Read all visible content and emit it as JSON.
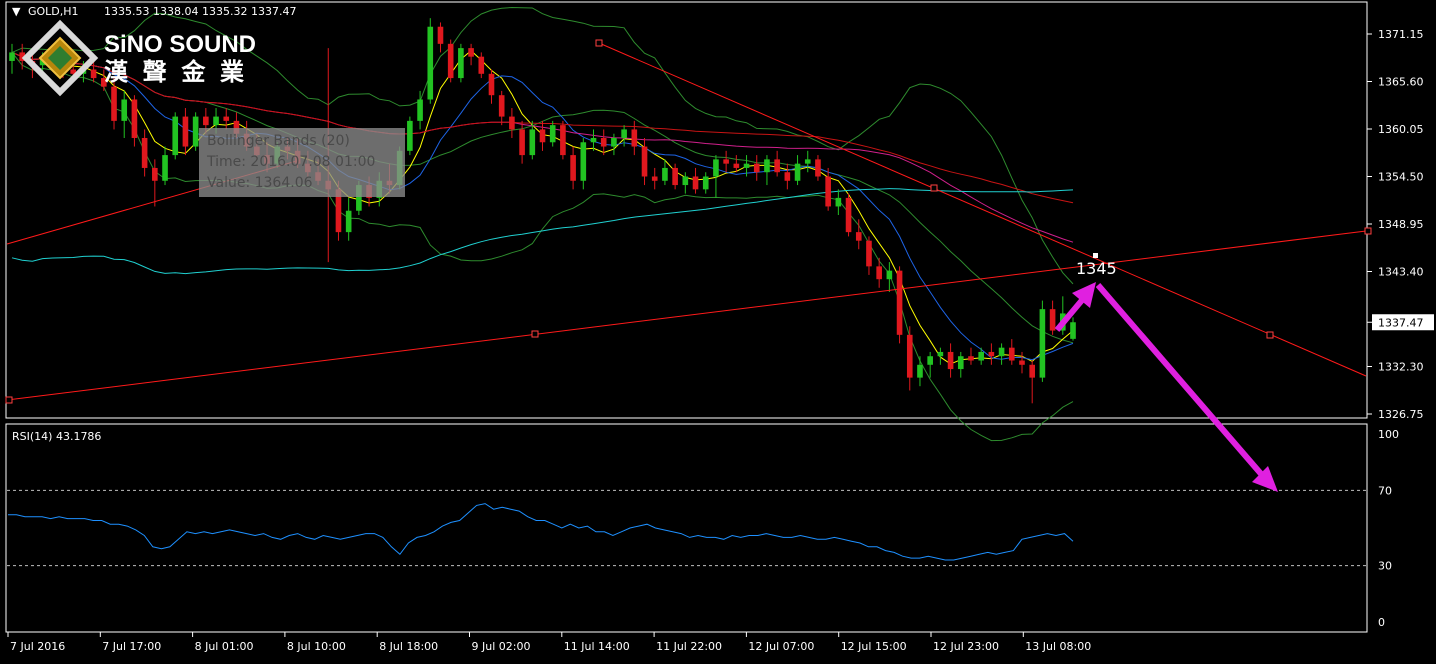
{
  "header": {
    "symbol": "GOLD,H1",
    "ohlc": "1335.53 1338.04 1335.32 1337.47"
  },
  "logo": {
    "name": "SiNO SOUND",
    "chinese": "漢 聲 金 業"
  },
  "tooltip": {
    "line1": "Bollinger Bands (20)",
    "line2": "Time: 2016.07.08 01:00",
    "line3": "Value: 1364.06"
  },
  "annotation": {
    "label": "1345"
  },
  "price_axis": {
    "ticks": [
      "1371.15",
      "1365.60",
      "1360.05",
      "1354.50",
      "1348.95",
      "1343.40",
      "1337.47",
      "1332.30",
      "1326.75"
    ],
    "current_price": "1337.47"
  },
  "rsi": {
    "label": "RSI(14) 43.1786",
    "ticks": [
      "100",
      "70",
      "30",
      "0"
    ]
  },
  "time_axis": {
    "labels": [
      "7 Jul 2016",
      "7 Jul 17:00",
      "8 Jul 01:00",
      "8 Jul 10:00",
      "8 Jul 18:00",
      "9 Jul 02:00",
      "11 Jul 14:00",
      "11 Jul 22:00",
      "12 Jul 07:00",
      "12 Jul 15:00",
      "12 Jul 23:00",
      "13 Jul 08:00"
    ]
  },
  "colors": {
    "background": "#000000",
    "bull": "#22c322",
    "bear": "#e0181e",
    "bollinger": "#2e8b2e",
    "ma_yellow": "#ffff00",
    "ma_blue": "#1e64e6",
    "ma_magenta": "#d0208c",
    "ma_red": "#c81414",
    "ma_cyan": "#20d0d0",
    "trendline": "#ff1a1a",
    "rsi_line": "#1e90ff",
    "arrow": "#e020e0",
    "axis": "#ffffff"
  },
  "chart_data": {
    "type": "candlestick",
    "title": "GOLD,H1",
    "ylim": [
      1325,
      1373
    ],
    "candles": [
      {
        "o": 1368.0,
        "h": 1370.0,
        "l": 1366.5,
        "c": 1369.0
      },
      {
        "o": 1369.0,
        "h": 1370.0,
        "l": 1367.0,
        "c": 1368.0
      },
      {
        "o": 1368.0,
        "h": 1369.5,
        "l": 1366.0,
        "c": 1367.5
      },
      {
        "o": 1367.5,
        "h": 1369.0,
        "l": 1366.5,
        "c": 1368.5
      },
      {
        "o": 1368.5,
        "h": 1369.5,
        "l": 1367.0,
        "c": 1367.5
      },
      {
        "o": 1367.5,
        "h": 1368.5,
        "l": 1366.0,
        "c": 1367.0
      },
      {
        "o": 1367.0,
        "h": 1368.0,
        "l": 1365.5,
        "c": 1366.5
      },
      {
        "o": 1366.5,
        "h": 1368.0,
        "l": 1365.5,
        "c": 1367.0
      },
      {
        "o": 1367.0,
        "h": 1368.0,
        "l": 1365.5,
        "c": 1366.0
      },
      {
        "o": 1366.0,
        "h": 1367.0,
        "l": 1364.5,
        "c": 1365.0
      },
      {
        "o": 1365.0,
        "h": 1366.0,
        "l": 1360.0,
        "c": 1361.0
      },
      {
        "o": 1361.0,
        "h": 1364.5,
        "l": 1359.0,
        "c": 1363.5
      },
      {
        "o": 1363.5,
        "h": 1364.0,
        "l": 1358.0,
        "c": 1359.0
      },
      {
        "o": 1359.0,
        "h": 1360.0,
        "l": 1354.5,
        "c": 1355.5
      },
      {
        "o": 1355.5,
        "h": 1356.5,
        "l": 1351.0,
        "c": 1354.0
      },
      {
        "o": 1354.0,
        "h": 1358.0,
        "l": 1353.5,
        "c": 1357.0
      },
      {
        "o": 1357.0,
        "h": 1362.0,
        "l": 1356.5,
        "c": 1361.5
      },
      {
        "o": 1361.5,
        "h": 1362.5,
        "l": 1357.0,
        "c": 1358.0
      },
      {
        "o": 1358.0,
        "h": 1362.0,
        "l": 1357.5,
        "c": 1361.5
      },
      {
        "o": 1361.5,
        "h": 1362.5,
        "l": 1359.5,
        "c": 1360.5
      },
      {
        "o": 1360.5,
        "h": 1362.5,
        "l": 1359.5,
        "c": 1361.5
      },
      {
        "o": 1361.5,
        "h": 1362.5,
        "l": 1360.0,
        "c": 1361.0
      },
      {
        "o": 1361.0,
        "h": 1362.0,
        "l": 1359.0,
        "c": 1359.5
      },
      {
        "o": 1359.5,
        "h": 1361.0,
        "l": 1357.5,
        "c": 1358.0
      },
      {
        "o": 1358.0,
        "h": 1359.5,
        "l": 1356.5,
        "c": 1357.0
      },
      {
        "o": 1357.0,
        "h": 1358.5,
        "l": 1355.0,
        "c": 1356.0
      },
      {
        "o": 1356.0,
        "h": 1358.5,
        "l": 1355.5,
        "c": 1358.0
      },
      {
        "o": 1358.0,
        "h": 1359.0,
        "l": 1356.5,
        "c": 1357.5
      },
      {
        "o": 1357.5,
        "h": 1359.0,
        "l": 1355.5,
        "c": 1356.0
      },
      {
        "o": 1356.0,
        "h": 1357.5,
        "l": 1354.5,
        "c": 1355.0
      },
      {
        "o": 1355.0,
        "h": 1356.5,
        "l": 1353.5,
        "c": 1354.0
      },
      {
        "o": 1354.0,
        "h": 1369.5,
        "l": 1344.5,
        "c": 1353.0
      },
      {
        "o": 1353.0,
        "h": 1354.0,
        "l": 1347.0,
        "c": 1348.0
      },
      {
        "o": 1348.0,
        "h": 1352.0,
        "l": 1347.0,
        "c": 1350.5
      },
      {
        "o": 1350.5,
        "h": 1354.0,
        "l": 1350.0,
        "c": 1353.5
      },
      {
        "o": 1353.5,
        "h": 1354.5,
        "l": 1351.0,
        "c": 1352.0
      },
      {
        "o": 1352.0,
        "h": 1355.0,
        "l": 1351.0,
        "c": 1354.0
      },
      {
        "o": 1354.0,
        "h": 1356.0,
        "l": 1352.5,
        "c": 1353.5
      },
      {
        "o": 1353.5,
        "h": 1358.0,
        "l": 1353.0,
        "c": 1357.5
      },
      {
        "o": 1357.5,
        "h": 1361.5,
        "l": 1357.0,
        "c": 1361.0
      },
      {
        "o": 1361.0,
        "h": 1364.5,
        "l": 1360.0,
        "c": 1363.5
      },
      {
        "o": 1363.5,
        "h": 1373.0,
        "l": 1363.0,
        "c": 1372.0
      },
      {
        "o": 1372.0,
        "h": 1372.5,
        "l": 1369.0,
        "c": 1370.0
      },
      {
        "o": 1370.0,
        "h": 1370.5,
        "l": 1365.5,
        "c": 1366.0
      },
      {
        "o": 1366.0,
        "h": 1370.0,
        "l": 1365.5,
        "c": 1369.5
      },
      {
        "o": 1369.5,
        "h": 1370.0,
        "l": 1367.5,
        "c": 1368.5
      },
      {
        "o": 1368.5,
        "h": 1369.0,
        "l": 1366.0,
        "c": 1366.5
      },
      {
        "o": 1366.5,
        "h": 1367.0,
        "l": 1363.0,
        "c": 1364.0
      },
      {
        "o": 1364.0,
        "h": 1364.5,
        "l": 1360.5,
        "c": 1361.5
      },
      {
        "o": 1361.5,
        "h": 1362.5,
        "l": 1359.0,
        "c": 1360.0
      },
      {
        "o": 1360.0,
        "h": 1361.0,
        "l": 1356.0,
        "c": 1357.0
      },
      {
        "o": 1357.0,
        "h": 1361.0,
        "l": 1356.5,
        "c": 1360.0
      },
      {
        "o": 1360.0,
        "h": 1361.0,
        "l": 1357.5,
        "c": 1358.5
      },
      {
        "o": 1358.5,
        "h": 1361.0,
        "l": 1358.0,
        "c": 1360.5
      },
      {
        "o": 1360.5,
        "h": 1361.0,
        "l": 1356.5,
        "c": 1357.0
      },
      {
        "o": 1357.0,
        "h": 1358.0,
        "l": 1353.0,
        "c": 1354.0
      },
      {
        "o": 1354.0,
        "h": 1359.0,
        "l": 1353.0,
        "c": 1358.5
      },
      {
        "o": 1358.5,
        "h": 1360.0,
        "l": 1357.5,
        "c": 1359.0
      },
      {
        "o": 1359.0,
        "h": 1360.0,
        "l": 1357.0,
        "c": 1358.0
      },
      {
        "o": 1358.0,
        "h": 1359.5,
        "l": 1357.0,
        "c": 1359.0
      },
      {
        "o": 1359.0,
        "h": 1360.5,
        "l": 1358.0,
        "c": 1360.0
      },
      {
        "o": 1360.0,
        "h": 1361.0,
        "l": 1357.0,
        "c": 1358.0
      },
      {
        "o": 1358.0,
        "h": 1359.0,
        "l": 1353.5,
        "c": 1354.5
      },
      {
        "o": 1354.5,
        "h": 1355.5,
        "l": 1353.0,
        "c": 1354.0
      },
      {
        "o": 1354.0,
        "h": 1356.5,
        "l": 1353.5,
        "c": 1355.5
      },
      {
        "o": 1355.5,
        "h": 1356.0,
        "l": 1353.0,
        "c": 1353.5
      },
      {
        "o": 1353.5,
        "h": 1355.0,
        "l": 1352.5,
        "c": 1354.5
      },
      {
        "o": 1354.5,
        "h": 1355.5,
        "l": 1352.5,
        "c": 1353.0
      },
      {
        "o": 1353.0,
        "h": 1355.0,
        "l": 1352.5,
        "c": 1354.5
      },
      {
        "o": 1354.5,
        "h": 1357.0,
        "l": 1352.0,
        "c": 1356.5
      },
      {
        "o": 1356.5,
        "h": 1357.5,
        "l": 1355.0,
        "c": 1356.0
      },
      {
        "o": 1356.0,
        "h": 1357.0,
        "l": 1355.0,
        "c": 1355.5
      },
      {
        "o": 1355.5,
        "h": 1357.0,
        "l": 1354.5,
        "c": 1356.0
      },
      {
        "o": 1356.0,
        "h": 1357.0,
        "l": 1354.0,
        "c": 1355.0
      },
      {
        "o": 1355.0,
        "h": 1357.0,
        "l": 1353.5,
        "c": 1356.5
      },
      {
        "o": 1356.5,
        "h": 1357.5,
        "l": 1354.5,
        "c": 1355.0
      },
      {
        "o": 1355.0,
        "h": 1356.0,
        "l": 1353.0,
        "c": 1354.0
      },
      {
        "o": 1354.0,
        "h": 1357.0,
        "l": 1353.5,
        "c": 1356.0
      },
      {
        "o": 1356.0,
        "h": 1357.5,
        "l": 1355.0,
        "c": 1356.5
      },
      {
        "o": 1356.5,
        "h": 1357.0,
        "l": 1354.0,
        "c": 1354.5
      },
      {
        "o": 1354.5,
        "h": 1355.5,
        "l": 1350.5,
        "c": 1351.0
      },
      {
        "o": 1351.0,
        "h": 1353.0,
        "l": 1350.0,
        "c": 1352.0
      },
      {
        "o": 1352.0,
        "h": 1352.5,
        "l": 1347.5,
        "c": 1348.0
      },
      {
        "o": 1348.0,
        "h": 1349.5,
        "l": 1346.0,
        "c": 1347.0
      },
      {
        "o": 1347.0,
        "h": 1347.5,
        "l": 1343.0,
        "c": 1344.0
      },
      {
        "o": 1344.0,
        "h": 1345.0,
        "l": 1341.5,
        "c": 1342.5
      },
      {
        "o": 1342.5,
        "h": 1344.5,
        "l": 1341.0,
        "c": 1343.5
      },
      {
        "o": 1343.5,
        "h": 1344.0,
        "l": 1335.0,
        "c": 1336.0
      },
      {
        "o": 1336.0,
        "h": 1337.0,
        "l": 1329.5,
        "c": 1331.0
      },
      {
        "o": 1331.0,
        "h": 1333.5,
        "l": 1330.0,
        "c": 1332.5
      },
      {
        "o": 1332.5,
        "h": 1334.0,
        "l": 1331.0,
        "c": 1333.5
      },
      {
        "o": 1333.5,
        "h": 1334.5,
        "l": 1332.5,
        "c": 1334.0
      },
      {
        "o": 1334.0,
        "h": 1335.0,
        "l": 1331.0,
        "c": 1332.0
      },
      {
        "o": 1332.0,
        "h": 1334.0,
        "l": 1331.0,
        "c": 1333.5
      },
      {
        "o": 1333.5,
        "h": 1334.5,
        "l": 1332.5,
        "c": 1333.0
      },
      {
        "o": 1333.0,
        "h": 1334.5,
        "l": 1332.5,
        "c": 1334.0
      },
      {
        "o": 1334.0,
        "h": 1335.0,
        "l": 1332.5,
        "c": 1333.5
      },
      {
        "o": 1333.5,
        "h": 1335.0,
        "l": 1332.5,
        "c": 1334.5
      },
      {
        "o": 1334.5,
        "h": 1335.5,
        "l": 1332.5,
        "c": 1333.0
      },
      {
        "o": 1333.0,
        "h": 1334.0,
        "l": 1331.5,
        "c": 1332.5
      },
      {
        "o": 1332.5,
        "h": 1333.0,
        "l": 1328.0,
        "c": 1331.0
      },
      {
        "o": 1331.0,
        "h": 1340.0,
        "l": 1330.5,
        "c": 1339.0
      },
      {
        "o": 1339.0,
        "h": 1340.0,
        "l": 1336.0,
        "c": 1336.5
      },
      {
        "o": 1336.5,
        "h": 1340.5,
        "l": 1336.0,
        "c": 1338.5
      },
      {
        "o": 1335.53,
        "h": 1338.04,
        "l": 1335.32,
        "c": 1337.47
      }
    ],
    "rsi": [
      57,
      57,
      56,
      56,
      56,
      55,
      56,
      55,
      55,
      55,
      54,
      54,
      52,
      52,
      51,
      49,
      46,
      40,
      39,
      40,
      44,
      48,
      47,
      48,
      47,
      48,
      49,
      48,
      47,
      46,
      47,
      45,
      44,
      46,
      47,
      45,
      44,
      46,
      45,
      44,
      45,
      46,
      47,
      47,
      45,
      40,
      36,
      42,
      45,
      46,
      48,
      51,
      53,
      54,
      58,
      62,
      63,
      60,
      61,
      60,
      59,
      56,
      54,
      54,
      52,
      50,
      52,
      50,
      51,
      48,
      48,
      46,
      48,
      50,
      51,
      52,
      50,
      49,
      48,
      47,
      45,
      46,
      45,
      45,
      44,
      46,
      45,
      46,
      46,
      47,
      46,
      45,
      45,
      46,
      45,
      44,
      44,
      45,
      44,
      43,
      42,
      40,
      40,
      38,
      37,
      35,
      34,
      34,
      35,
      34,
      33,
      33,
      34,
      35,
      36,
      37,
      36,
      37,
      38,
      44,
      45,
      46,
      47,
      46,
      47,
      43
    ]
  }
}
